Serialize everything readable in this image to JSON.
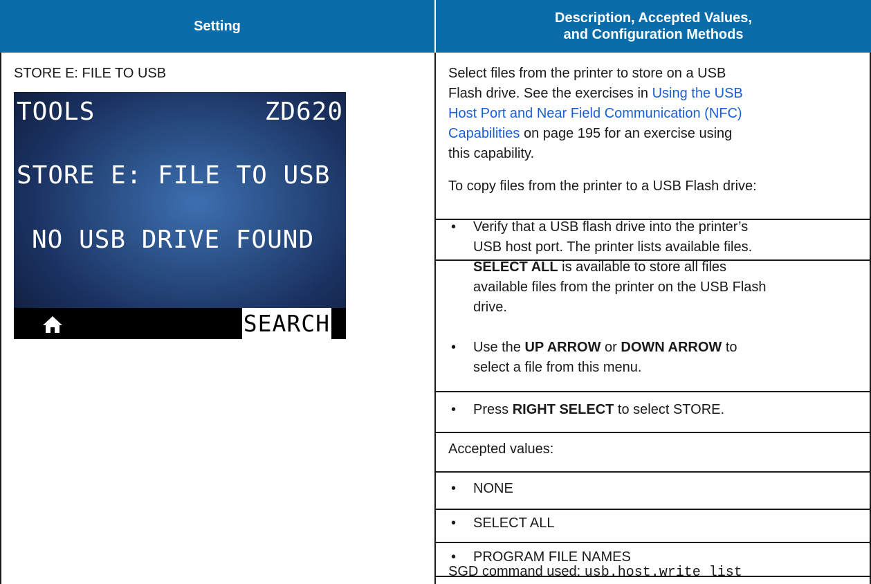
{
  "header": {
    "setting": "Setting",
    "desc_line1": "Description, Accepted Values,",
    "desc_line2": "and Configuration Methods"
  },
  "setting_label": "STORE E: FILE TO USB",
  "lcd": {
    "title": "TOOLS",
    "model": "ZD620",
    "menu_item": "STORE E: FILE TO USB",
    "status": "NO USB DRIVE FOUND",
    "home_icon": "home-icon",
    "search_label": "SEARCH"
  },
  "description": {
    "intro_1": "Select files from the printer to store on a USB",
    "intro_2": "Flash drive. See the exercises in ",
    "link_1": "Using the USB",
    "link_2": "Host Port and Near Field Communication (NFC)",
    "link_3": "Capabilities",
    "intro_3": " on page 195 for an exercise using",
    "intro_4": "this capability.",
    "copy_heading": "To copy files from the printer to a USB Flash drive:",
    "bullet1_l1": "Verify that a USB flash drive into the printer’s",
    "bullet1_l2": "USB host port. The printer lists available files.",
    "bullet1_bold": "SELECT ALL",
    "bullet1_l3": " is available to store all files",
    "bullet1_l4": "available files from the printer on the USB Flash",
    "bullet1_l5": "drive.",
    "bullet2_pre": "Use the ",
    "bullet2_b1": "UP ARROW",
    "bullet2_mid": " or ",
    "bullet2_b2": "DOWN ARROW",
    "bullet2_post": " to",
    "bullet2_l2": "select a file from this menu.",
    "bullet3_pre": "Press ",
    "bullet3_b": "RIGHT SELECT",
    "bullet3_post": " to select STORE.",
    "accepted_heading": "Accepted values:",
    "values": [
      "NONE",
      "SELECT ALL",
      "PROGRAM FILE NAMES"
    ],
    "sgd_label": "SGD command used: ",
    "sgd_command": "usb.host.write_list"
  }
}
